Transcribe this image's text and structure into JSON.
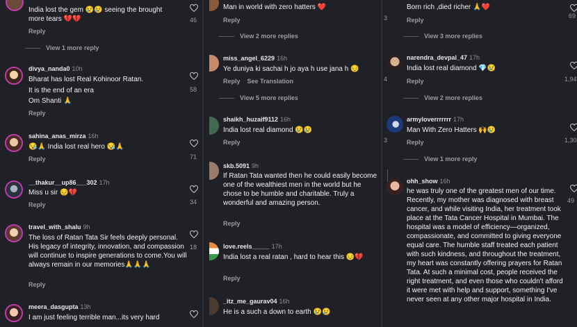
{
  "col1": {
    "c0": {
      "text": "India lost the gem 😢😢 seeing the brought more tears 💔💔",
      "reply": "Reply",
      "likes": "46"
    },
    "more1": "View 1 more reply",
    "c1": {
      "user": "divya_nanda0",
      "time": "10h",
      "text1": "Bharat has lost Real Kohinoor Ratan.",
      "text2": "It is the end of an era",
      "text3": "Om Shanti 🙏",
      "reply": "Reply",
      "likes": "58"
    },
    "c2": {
      "user": "sahina_anas_mirza",
      "time": "16h",
      "text": "😪🙏 India lost real hero 😪🙏",
      "reply": "Reply",
      "likes": "71"
    },
    "c3": {
      "user": "__thakur__up86___302",
      "time": "17h",
      "text": "Miss u sir 😔💔",
      "reply": "Reply",
      "likes": "34"
    },
    "c4": {
      "user": "travel_with_shalu",
      "time": "9h",
      "text": "The loss of Ratan Tata Sir feels deeply personal. His legacy of integrity, innovation, and compassion will continue to inspire generations to come.You will always remain in our memories🙏🙏🙏",
      "reply": "Reply",
      "likes": "18"
    },
    "c5": {
      "user": "meera_dasgupta",
      "time": "13h",
      "text": "I am just feeling terrible man...its very hard"
    }
  },
  "col2": {
    "c0": {
      "text": "Man in world with zero hatters ❤️",
      "reply": "Reply"
    },
    "more1": "View 2 more replies",
    "c1": {
      "user": "miss_angel_6229",
      "time": "16h",
      "text": "Ye duniya ki sachai h jo aya h use jana h 😔",
      "reply": "Reply",
      "translate": "See Translation"
    },
    "more2": "View 5 more replies",
    "c2": {
      "user": "shaikh_huzaif9112",
      "time": "16h",
      "text": "India lost real diamond 😢😢",
      "reply": "Reply"
    },
    "c3": {
      "user": "skb.5091",
      "time": "9h",
      "text": "If Ratan Tata wanted then he could easily become one of the wealthiest men in the world but he chose to be humble and charitable. Truly a wonderful and amazing person.",
      "reply": "Reply"
    },
    "c4": {
      "user": "love.reels_____",
      "time": "17h",
      "text": "India lost a real ratan , hard to hear this 😔💔",
      "reply": "Reply"
    },
    "c5": {
      "user": "_itz_me_gaurav04",
      "time": "16h",
      "text": "He is a such a down to earth 😢😢"
    }
  },
  "col3": {
    "c0": {
      "text": "Born rich ,died richer 🙏❤️",
      "reply": "Reply",
      "likes": "3",
      "likes2": "69"
    },
    "more1": "View 3 more replies",
    "c1": {
      "user": "narendra_devpal_47",
      "time": "17h",
      "text": "India lost real diamond 💎😢",
      "reply": "Reply",
      "likes": "4",
      "likes2": "1,94"
    },
    "more2": "View 2 more replies",
    "c2": {
      "user": "armyloverrrrrrr",
      "time": "17h",
      "text": "Man With Zero Hatters 🙌😢",
      "reply": "Reply",
      "likes": "3",
      "likes2": "1,30"
    },
    "more3": "View 1 more reply",
    "c3": {
      "user": "ohh_show",
      "time": "16h",
      "text": "he was truly one of the greatest men of our time. Recently, my mother was diagnosed with breast cancer, and while visiting India, her treatment took place at the Tata Cancer Hospital in Mumbai. The hospital was a model of efficiency—organized, compassionate, and committed to giving everyone equal care. The humble staff treated each patient with such kindness, and throughout the treatment, my heart was constantly offering prayers for Ratan Tata. At such a minimal cost, people received the right treatment, and even those who couldn't afford it were met with help and support, something I've never seen at any other major hospital in India.",
      "likes2": "49"
    }
  }
}
